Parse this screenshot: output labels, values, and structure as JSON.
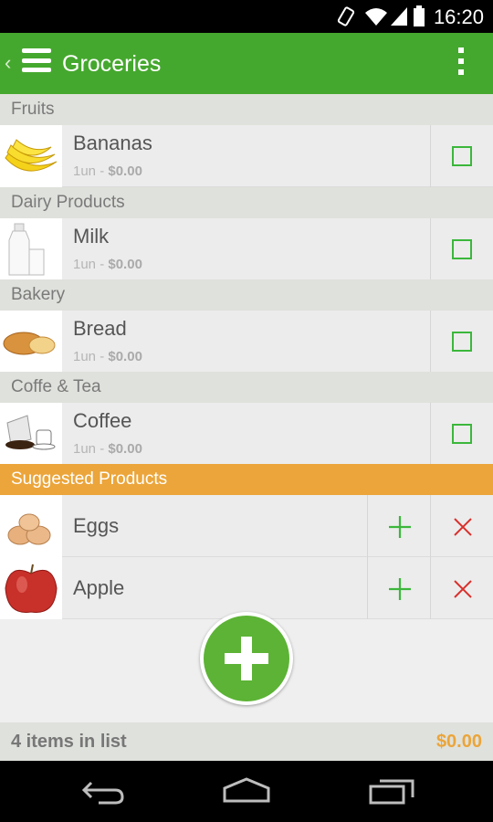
{
  "status_bar": {
    "time": "16:20"
  },
  "action_bar": {
    "title": "Groceries"
  },
  "sections": [
    {
      "header": "Fruits",
      "item": {
        "name": "Bananas",
        "quantity": "1un",
        "separator": "-",
        "price": "$0.00",
        "checked": false
      }
    },
    {
      "header": "Dairy Products",
      "item": {
        "name": "Milk",
        "quantity": "1un",
        "separator": "-",
        "price": "$0.00",
        "checked": false
      }
    },
    {
      "header": "Bakery",
      "item": {
        "name": "Bread",
        "quantity": "1un",
        "separator": "-",
        "price": "$0.00",
        "checked": false
      }
    },
    {
      "header": "Coffe & Tea",
      "item": {
        "name": "Coffee",
        "quantity": "1un",
        "separator": "-",
        "price": "$0.00",
        "checked": false
      }
    }
  ],
  "suggested": {
    "header": "Suggested Products",
    "items": [
      {
        "name": "Eggs"
      },
      {
        "name": "Apple"
      }
    ]
  },
  "footer": {
    "count_label": "4 items in list",
    "total": "$0.00"
  },
  "colors": {
    "primary": "#45a82e",
    "accent": "#eba53a",
    "checkbox": "#3bb73b",
    "remove": "#d9302c"
  },
  "icons": [
    "back-chevron-icon",
    "drawer-menu-icon",
    "overflow-menu-icon",
    "add-icon",
    "remove-icon",
    "nav-back-icon",
    "nav-home-icon",
    "nav-recents-icon"
  ]
}
